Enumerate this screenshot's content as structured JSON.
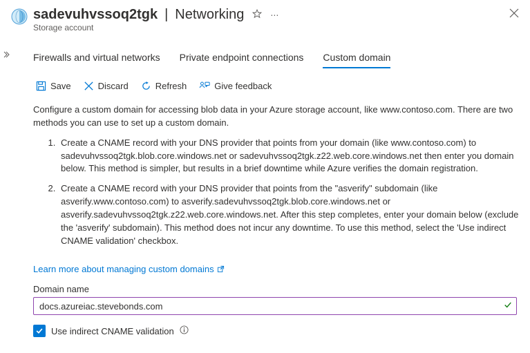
{
  "header": {
    "resource_name": "sadevuhvssoq2tgk",
    "section": "Networking",
    "subtitle": "Storage account"
  },
  "tabs": {
    "firewalls": "Firewalls and virtual networks",
    "private_endpoint": "Private endpoint connections",
    "custom_domain": "Custom domain"
  },
  "toolbar": {
    "save": "Save",
    "discard": "Discard",
    "refresh": "Refresh",
    "feedback": "Give feedback"
  },
  "body": {
    "description": "Configure a custom domain for accessing blob data in your Azure storage account, like www.contoso.com. There are two methods you can use to set up a custom domain.",
    "method1": "Create a CNAME record with your DNS provider that points from your domain (like www.contoso.com) to sadevuhvssoq2tgk.blob.core.windows.net or sadevuhvssoq2tgk.z22.web.core.windows.net then enter you domain below. This method is simpler, but results in a brief downtime while Azure verifies the domain registration.",
    "method2": "Create a CNAME record with your DNS provider that points from the \"asverify\" subdomain (like asverify.www.contoso.com) to asverify.sadevuhvssoq2tgk.blob.core.windows.net or asverify.sadevuhvssoq2tgk.z22.web.core.windows.net. After this step completes, enter your domain below (exclude the 'asverify' subdomain). This method does not incur any downtime. To use this method, select the 'Use indirect CNAME validation' checkbox.",
    "learn_more": "Learn more about managing custom domains",
    "domain_label": "Domain name",
    "domain_value": "docs.azureiac.stevebonds.com",
    "checkbox_label": "Use indirect CNAME validation"
  }
}
